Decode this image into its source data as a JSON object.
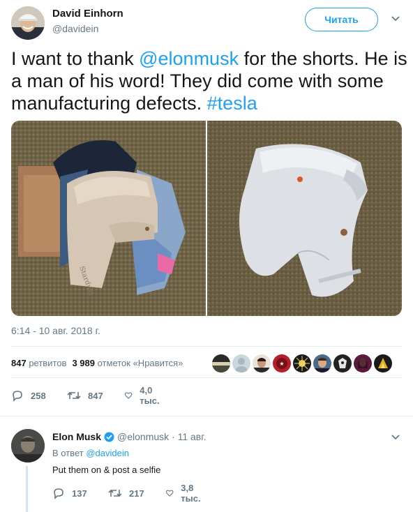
{
  "tweet": {
    "author": {
      "name": "David Einhorn",
      "handle": "@davidein",
      "avatar_icon": "profile-photo-man-with-cap"
    },
    "follow_label": "Читать",
    "text_parts": [
      "I want to thank ",
      "@elonmusk",
      " for the shorts. He is a man of his word!  They did come with some manufacturing defects. ",
      "#tesla"
    ],
    "photos": [
      {
        "icon": "photo-shorts-on-clothes-pile"
      },
      {
        "icon": "photo-white-shorts-on-carpet"
      }
    ],
    "timestamp": "6:14 - 10 авг. 2018 г.",
    "stats": {
      "retweets_count": "847",
      "retweets_label": "ретвитов",
      "likes_count": "3 989",
      "likes_label": "отметок «Нравится»"
    },
    "likers": [
      {
        "icon": "liker-avatar-1",
        "color": "#2b2b2b"
      },
      {
        "icon": "liker-avatar-2",
        "color": "#aab8c2"
      },
      {
        "icon": "liker-avatar-3",
        "color": "#3a3a3a"
      },
      {
        "icon": "liker-avatar-4",
        "color": "#b3202a"
      },
      {
        "icon": "liker-avatar-5",
        "color": "#1a1a1a"
      },
      {
        "icon": "liker-avatar-6",
        "color": "#4a6a8a"
      },
      {
        "icon": "liker-avatar-7",
        "color": "#222222"
      },
      {
        "icon": "liker-avatar-8",
        "color": "#5a1a3a"
      },
      {
        "icon": "liker-avatar-9",
        "color": "#e0b020"
      }
    ],
    "actions": {
      "replies": "258",
      "retweets": "847",
      "likes": "4,0 тыс."
    }
  },
  "reply": {
    "author_name": "Elon Musk",
    "handle_date": "@elonmusk · 11 авг.",
    "reply_to_prefix": "В ответ",
    "reply_to_handle": "@davidein",
    "text": "Put them on & post a selfie",
    "actions": {
      "replies": "137",
      "retweets": "217",
      "likes": "3,8 тыс."
    }
  },
  "colors": {
    "accent": "#1da1f2",
    "muted": "#657786",
    "divider": "#e6ecf0",
    "thread": "#cce6f7"
  }
}
